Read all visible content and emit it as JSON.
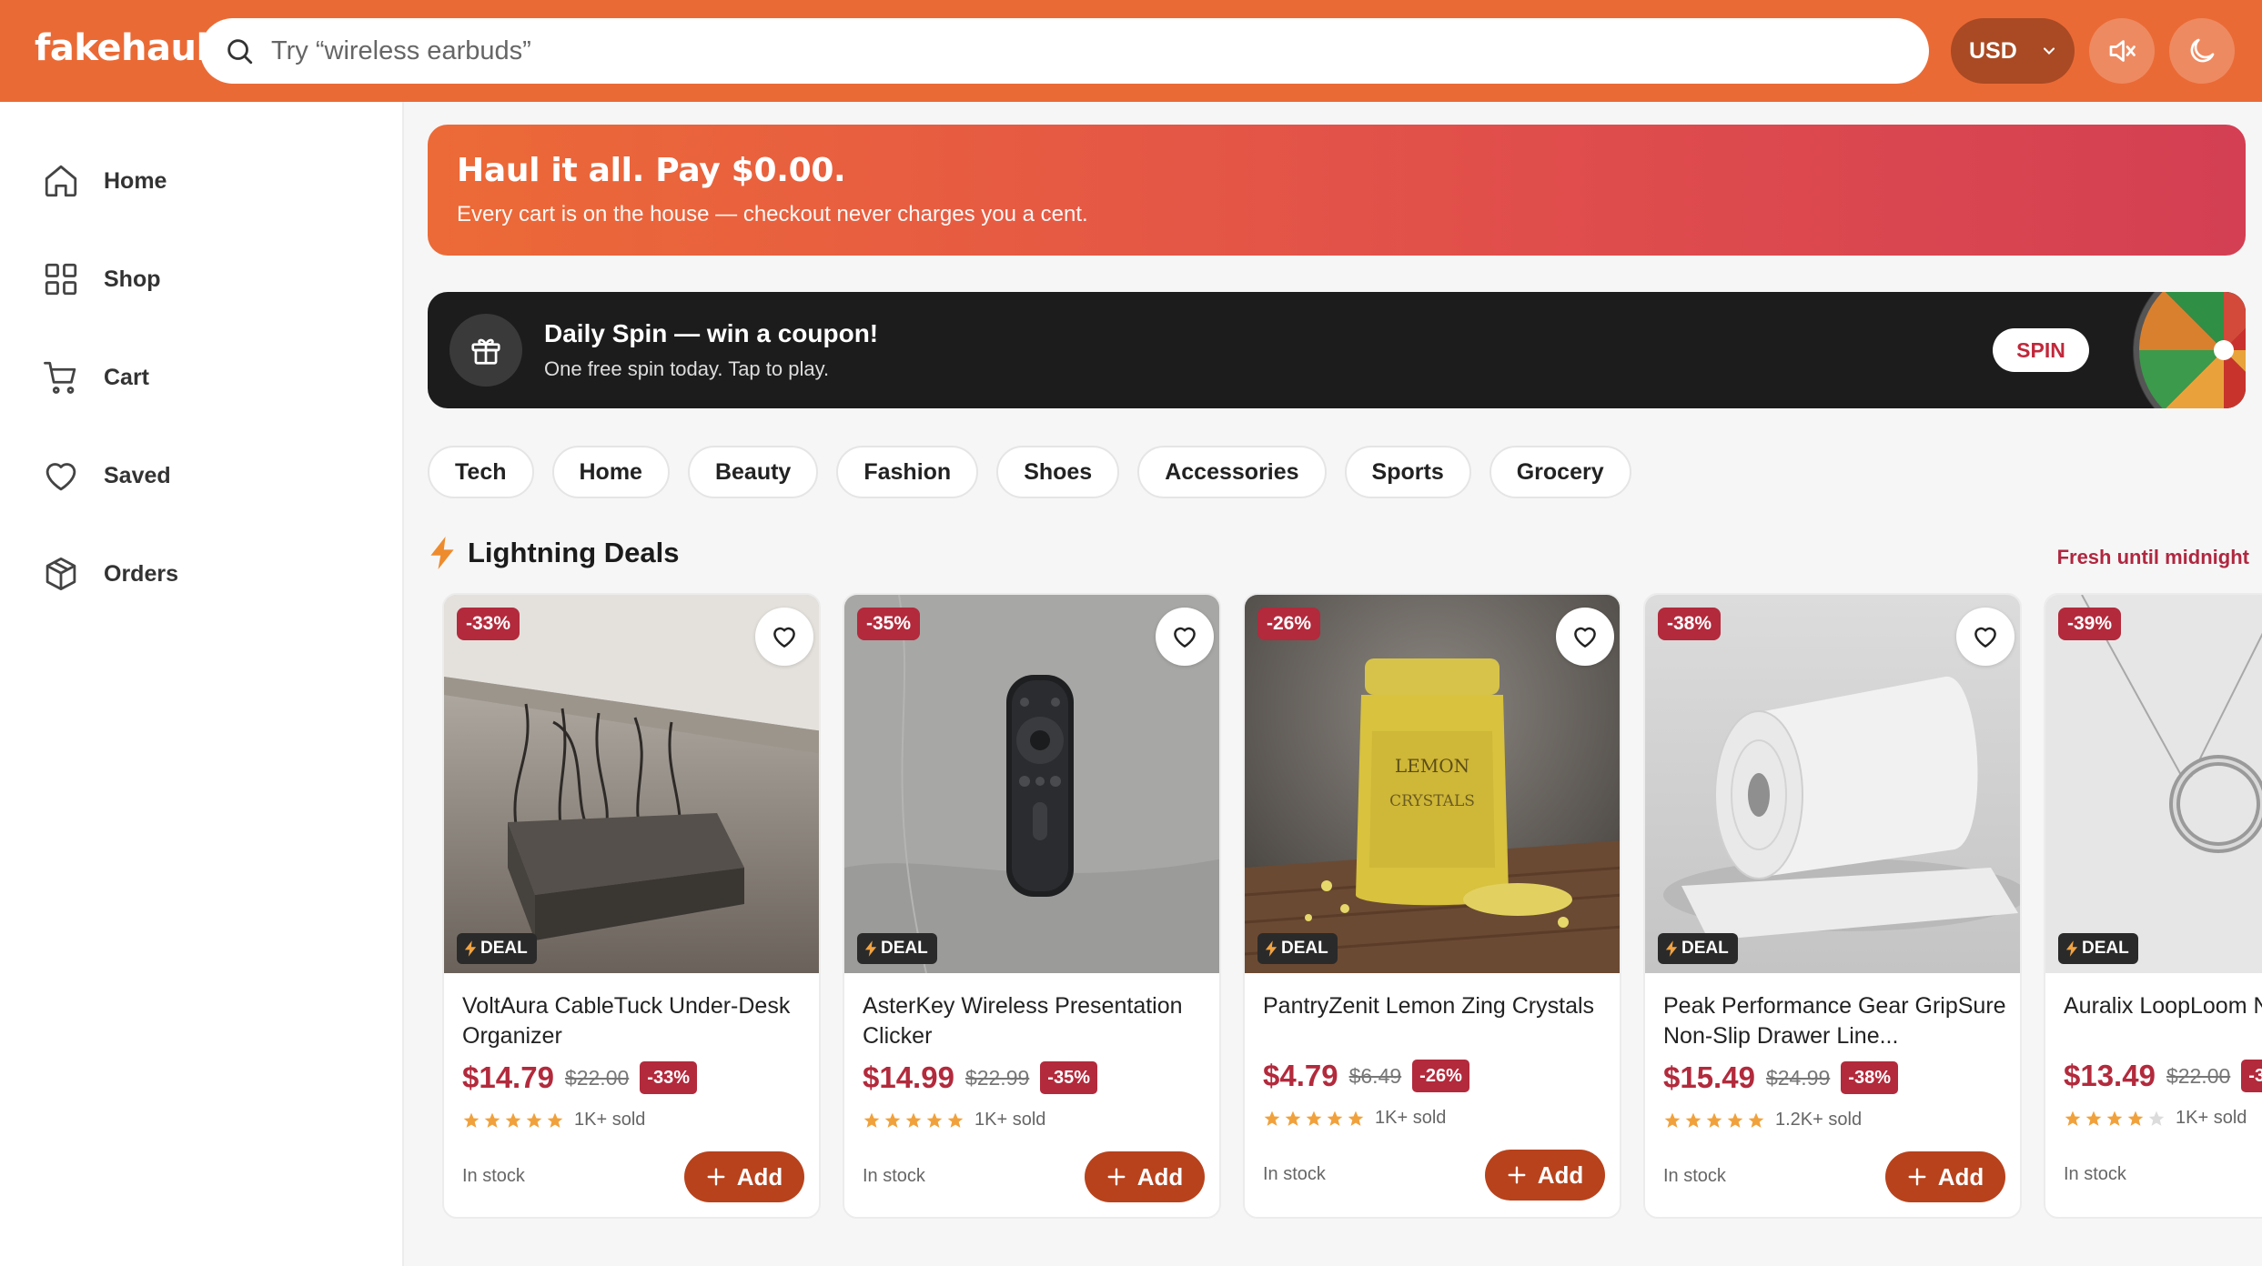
{
  "brand": "fakehaul",
  "search": {
    "placeholder": "Try “wireless earbuds”"
  },
  "currency": "USD",
  "sidebar": {
    "items": [
      {
        "label": "Home",
        "icon": "home-icon"
      },
      {
        "label": "Shop",
        "icon": "grid-icon"
      },
      {
        "label": "Cart",
        "icon": "cart-icon"
      },
      {
        "label": "Saved",
        "icon": "heart-icon"
      },
      {
        "label": "Orders",
        "icon": "package-icon"
      }
    ]
  },
  "hero": {
    "title": "Haul it all. Pay $0.00.",
    "subtitle": "Every cart is on the house — checkout never charges you a cent."
  },
  "spin": {
    "title": "Daily Spin — win a coupon!",
    "subtitle": "One free spin today. Tap to play.",
    "button": "SPIN"
  },
  "categories": [
    "Tech",
    "Home",
    "Beauty",
    "Fashion",
    "Shoes",
    "Accessories",
    "Sports",
    "Grocery"
  ],
  "deals": {
    "title": "Lightning Deals",
    "note": "Fresh until midnight",
    "deal_badge": "DEAL",
    "add_label": "Add",
    "products": [
      {
        "name": "VoltAura CableTuck Under-Desk Organizer",
        "price": "$14.79",
        "old_price": "$22.00",
        "discount": "-33%",
        "sold": "1K+ sold",
        "stock": "In stock",
        "rating": 5
      },
      {
        "name": "AsterKey Wireless Presentation Clicker",
        "price": "$14.99",
        "old_price": "$22.99",
        "discount": "-35%",
        "sold": "1K+ sold",
        "stock": "In stock",
        "rating": 5
      },
      {
        "name": "PantryZenit Lemon Zing Crystals",
        "price": "$4.79",
        "old_price": "$6.49",
        "discount": "-26%",
        "sold": "1K+ sold",
        "stock": "In stock",
        "rating": 5
      },
      {
        "name": "Peak Performance Gear GripSure Non-Slip Drawer Line...",
        "price": "$15.49",
        "old_price": "$24.99",
        "discount": "-38%",
        "sold": "1.2K+ sold",
        "stock": "In stock",
        "rating": 5
      },
      {
        "name": "Auralix LoopLoom N",
        "price": "$13.49",
        "old_price": "$22.00",
        "discount": "-39%",
        "sold": "1K+ sold",
        "stock": "In stock",
        "rating": 4
      }
    ]
  },
  "colors": {
    "brand": "#ea6a35",
    "accent": "#b22a3c",
    "add_button": "#b8421c"
  }
}
